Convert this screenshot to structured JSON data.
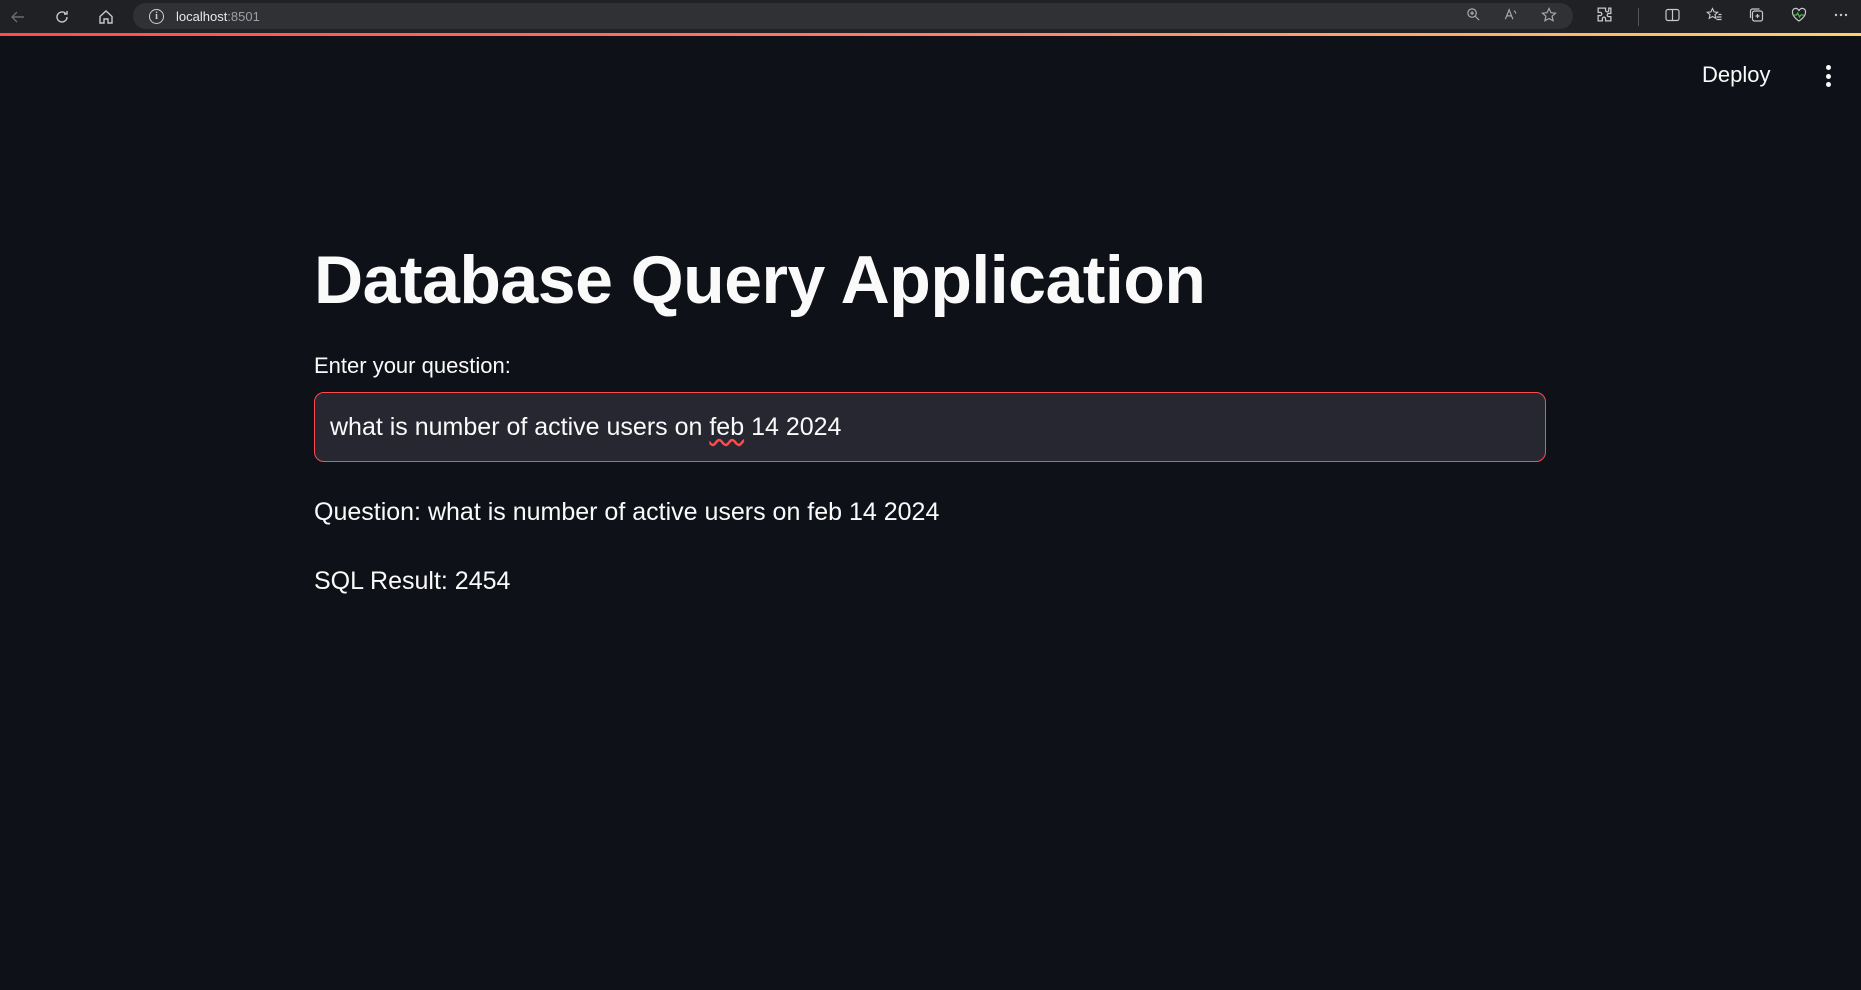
{
  "browser": {
    "url_host": "localhost",
    "url_port": ":8501",
    "icons": [
      "back-icon",
      "reload-icon",
      "home-icon",
      "info-icon",
      "zoom-icon",
      "read-aloud-icon",
      "favorite-icon",
      "extensions-icon",
      "split-screen-icon",
      "favorites-icon",
      "collections-icon",
      "browser-essentials-icon",
      "more-icon"
    ]
  },
  "header": {
    "deploy_label": "Deploy"
  },
  "main": {
    "title": "Database Query Application",
    "input_label": "Enter your question:",
    "input_value_prefix": "what is number of active users on ",
    "input_value_flagged": "feb",
    "input_value_suffix": " 14 2024",
    "question_text": "Question: what is number of active users on feb 14 2024",
    "sql_result_text": "SQL Result: 2454"
  },
  "colors": {
    "background": "#0e1117",
    "accent": "#ff4b4b",
    "input_bg": "#262730",
    "text": "#fafafa"
  }
}
